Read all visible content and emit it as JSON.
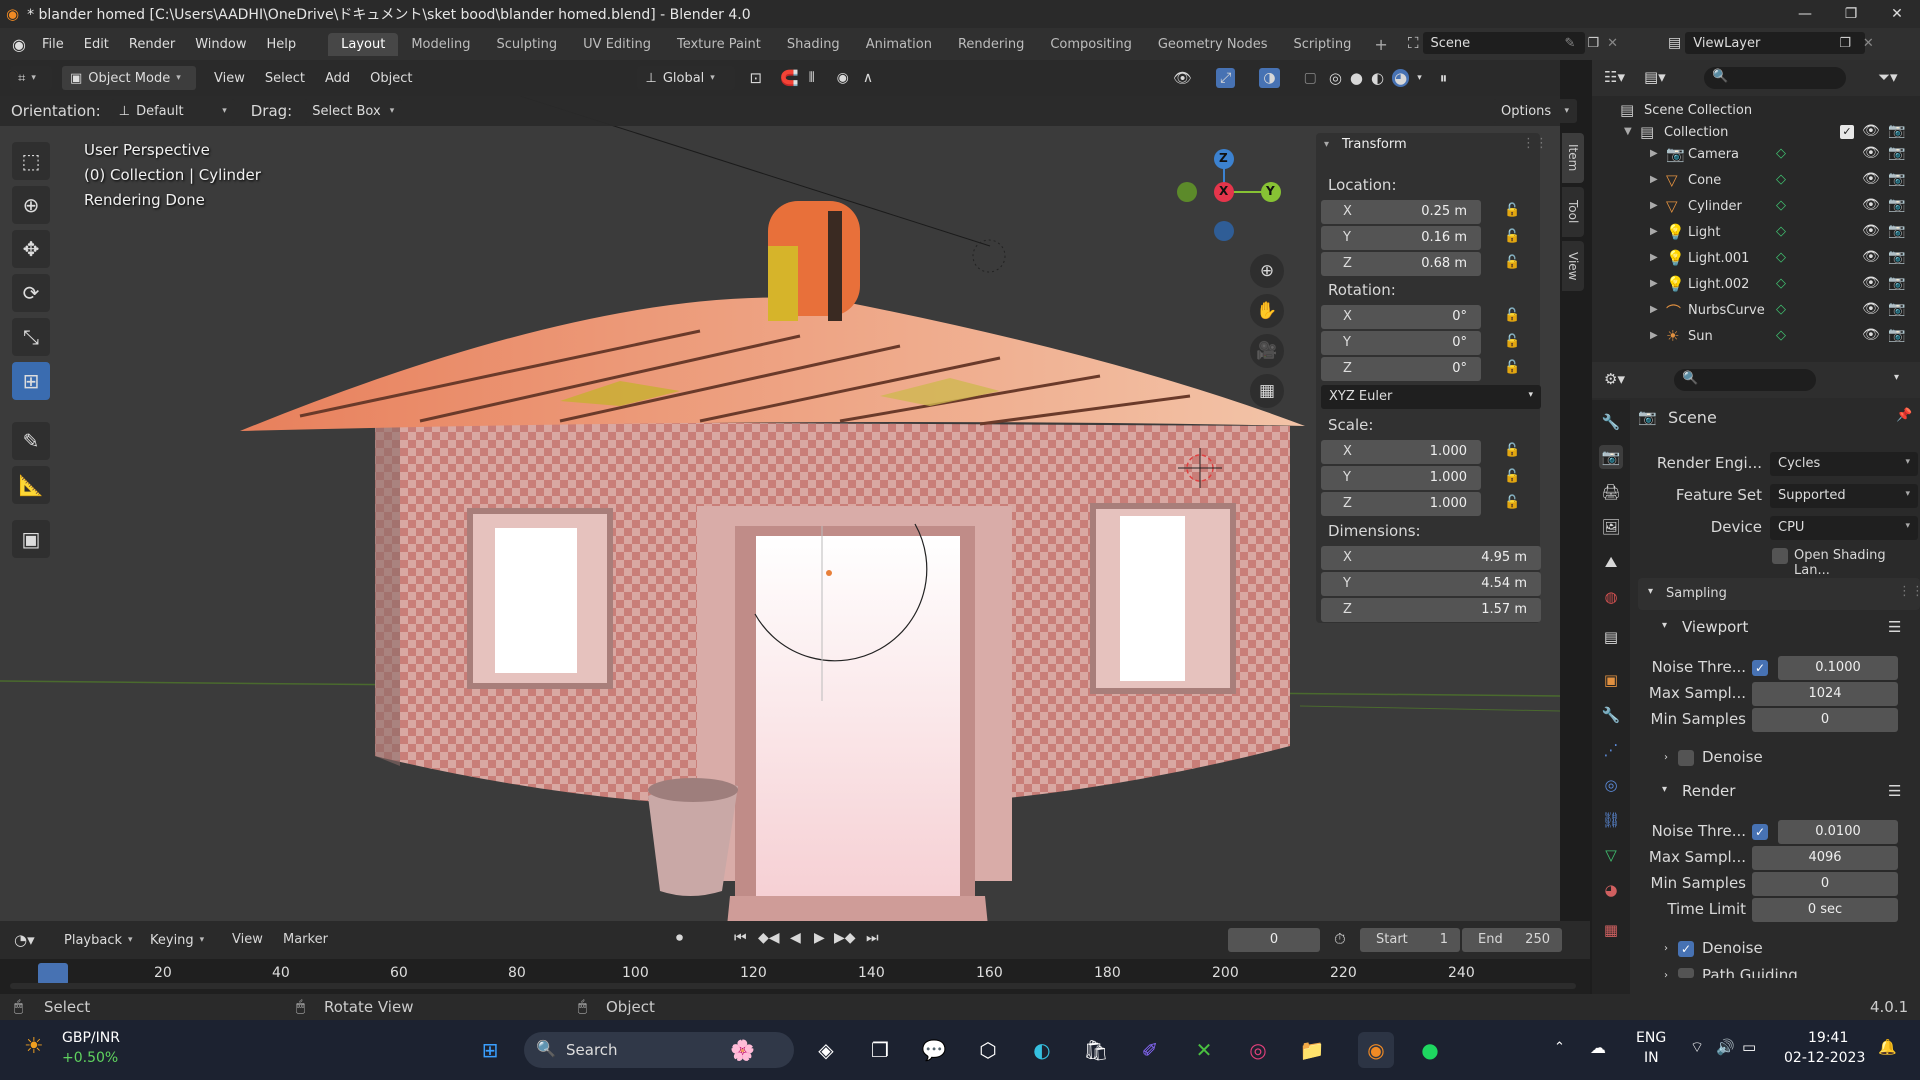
{
  "window": {
    "title": "* blander homed [C:\\Users\\AADHI\\OneDrive\\ドキュメント\\sket bood\\blander homed.blend] - Blender 4.0"
  },
  "menu": [
    "File",
    "Edit",
    "Render",
    "Window",
    "Help"
  ],
  "workspaces": [
    "Layout",
    "Modeling",
    "Sculpting",
    "UV Editing",
    "Texture Paint",
    "Shading",
    "Animation",
    "Rendering",
    "Compositing",
    "Geometry Nodes",
    "Scripting"
  ],
  "active_workspace": "Layout",
  "scene_name": "Scene",
  "view_layer": "ViewLayer",
  "viewport_header": {
    "mode": "Object Mode",
    "menus": [
      "View",
      "Select",
      "Add",
      "Object"
    ],
    "transform_orientation": "Global"
  },
  "tool_options": {
    "orientation_label": "Orientation:",
    "orientation_value": "Default",
    "drag_label": "Drag:",
    "drag_value": "Select Box",
    "options": "Options"
  },
  "overlay": {
    "view": "User Perspective",
    "collection": "(0) Collection | Cylinder",
    "status": "Rendering Done"
  },
  "gizmo": {
    "z": "Z",
    "x": "X",
    "y": "Y"
  },
  "transform_panel": {
    "title": "Transform",
    "location_label": "Location:",
    "location": [
      {
        "axis": "X",
        "value": "0.25 m"
      },
      {
        "axis": "Y",
        "value": "0.16 m"
      },
      {
        "axis": "Z",
        "value": "0.68 m"
      }
    ],
    "rotation_label": "Rotation:",
    "rotation": [
      {
        "axis": "X",
        "value": "0°"
      },
      {
        "axis": "Y",
        "value": "0°"
      },
      {
        "axis": "Z",
        "value": "0°"
      }
    ],
    "rotation_mode": "XYZ Euler",
    "scale_label": "Scale:",
    "scale": [
      {
        "axis": "X",
        "value": "1.000"
      },
      {
        "axis": "Y",
        "value": "1.000"
      },
      {
        "axis": "Z",
        "value": "1.000"
      }
    ],
    "dimensions_label": "Dimensions:",
    "dimensions": [
      {
        "axis": "X",
        "value": "4.95 m"
      },
      {
        "axis": "Y",
        "value": "4.54 m"
      },
      {
        "axis": "Z",
        "value": "1.57 m"
      }
    ]
  },
  "side_tabs": [
    "Item",
    "Tool",
    "View"
  ],
  "outliner": {
    "root": "Scene Collection",
    "collection": "Collection",
    "items": [
      {
        "name": "Camera",
        "icon": "camera-icon"
      },
      {
        "name": "Cone",
        "icon": "mesh-icon"
      },
      {
        "name": "Cylinder",
        "icon": "mesh-icon"
      },
      {
        "name": "Light",
        "icon": "light-icon"
      },
      {
        "name": "Light.001",
        "icon": "light-icon"
      },
      {
        "name": "Light.002",
        "icon": "light-icon"
      },
      {
        "name": "NurbsCurve",
        "icon": "curve-icon"
      },
      {
        "name": "Sun",
        "icon": "sun-icon"
      }
    ]
  },
  "properties": {
    "context": "Scene",
    "render_engine_label": "Render Engi...",
    "render_engine": "Cycles",
    "feature_set_label": "Feature Set",
    "feature_set": "Supported",
    "device_label": "Device",
    "device": "CPU",
    "open_shading": "Open Shading Lan...",
    "sampling": "Sampling",
    "viewport": "Viewport",
    "vp_noise_label": "Noise Thre...",
    "vp_noise": "0.1000",
    "vp_max_label": "Max Sampl...",
    "vp_max": "1024",
    "vp_min_label": "Min Samples",
    "vp_min": "0",
    "vp_denoise": "Denoise",
    "render": "Render",
    "r_noise_label": "Noise Thre...",
    "r_noise": "0.0100",
    "r_max_label": "Max Sampl...",
    "r_max": "4096",
    "r_min_label": "Min Samples",
    "r_min": "0",
    "time_limit_label": "Time Limit",
    "time_limit": "0 sec",
    "r_denoise": "Denoise",
    "path_guiding": "Path Guiding"
  },
  "timeline": {
    "menus": [
      "Playback",
      "Keying",
      "View",
      "Marker"
    ],
    "current_frame": "0",
    "start_label": "Start",
    "start": "1",
    "end_label": "End",
    "end": "250",
    "ticks": [
      "0",
      "20",
      "40",
      "60",
      "80",
      "100",
      "120",
      "140",
      "160",
      "180",
      "200",
      "220",
      "240"
    ]
  },
  "statusbar": {
    "select": "Select",
    "rotate": "Rotate View",
    "object": "Object",
    "version": "4.0.1"
  },
  "taskbar": {
    "widget_title": "GBP/INR",
    "widget_value": "+0.50%",
    "search": "Search",
    "lang1": "ENG",
    "lang2": "IN",
    "time": "19:41",
    "date": "02-12-2023"
  },
  "colors": {
    "accent": "#4772b3",
    "active_tool": "#3a6cb0",
    "gizmo_x": "#e5354b",
    "gizmo_y": "#87c234",
    "gizmo_z": "#3c82d0",
    "playhead": "#4772b3"
  }
}
